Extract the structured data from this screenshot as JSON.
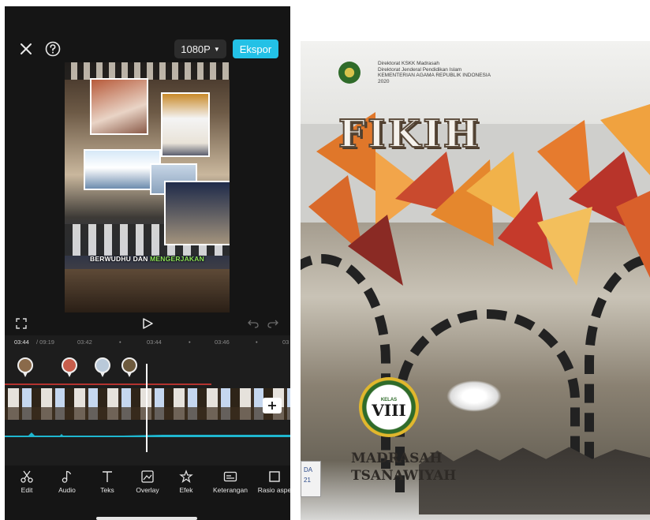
{
  "editor": {
    "resolution": "1080P",
    "export_label": "Ekspor",
    "preview_caption": {
      "part1": "BERWUDHU DAN ",
      "part2": "MENGERJAKAN"
    },
    "timeline": {
      "current_time": "03:44",
      "total_time": "/ 09:19",
      "ticks": [
        "03:42",
        "03:44",
        "03:46",
        "03"
      ]
    },
    "toolbar": [
      {
        "label": "Edit",
        "icon": "scissors-icon"
      },
      {
        "label": "Audio",
        "icon": "music-note-icon"
      },
      {
        "label": "Teks",
        "icon": "text-icon"
      },
      {
        "label": "Overlay",
        "icon": "overlay-icon"
      },
      {
        "label": "Efek",
        "icon": "effects-icon"
      },
      {
        "label": "Keterangan",
        "icon": "captions-icon"
      },
      {
        "label": "Rasio aspe",
        "icon": "aspect-ratio-icon"
      }
    ],
    "colors": {
      "accent": "#23c1e6",
      "caption_highlight": "#8fe65a",
      "audio_wave": "#1fb6cf"
    }
  },
  "book": {
    "publisher_lines": [
      "Direktorat KSKK Madrasah",
      "Direktorat Jenderal Pendidikan Islam",
      "KEMENTERIAN AGAMA REPUBLIK INDONESIA",
      "2020"
    ],
    "title": "FIKIH",
    "kelas_label": "KELAS",
    "kelas_value": "VIII",
    "subtitle_line1": "MADRASAH",
    "subtitle_line2": "TSANAWIYAH",
    "sticker_line1": "DA",
    "sticker_line2": "21"
  }
}
